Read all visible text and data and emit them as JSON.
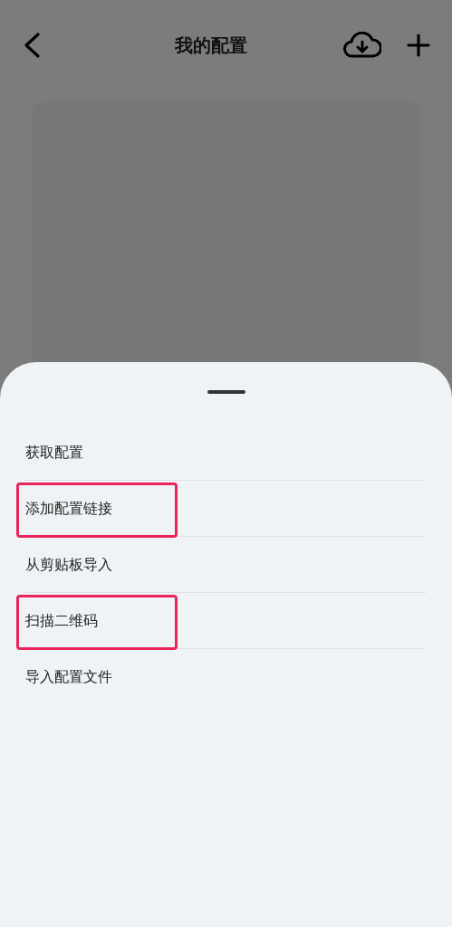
{
  "header": {
    "title": "我的配置"
  },
  "menu": {
    "items": [
      {
        "label": "获取配置",
        "highlighted": false
      },
      {
        "label": "添加配置链接",
        "highlighted": true
      },
      {
        "label": "从剪贴板导入",
        "highlighted": false
      },
      {
        "label": "扫描二维码",
        "highlighted": true
      },
      {
        "label": "导入配置文件",
        "highlighted": false
      }
    ]
  }
}
